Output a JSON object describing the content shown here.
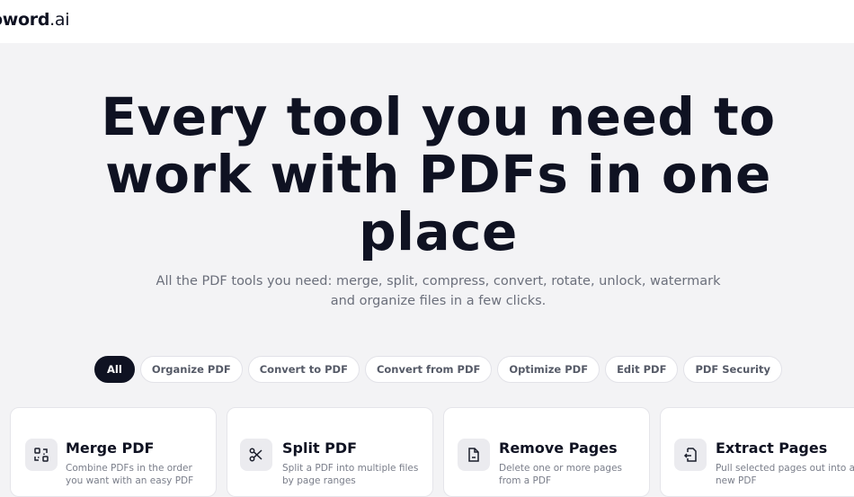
{
  "header": {
    "logo_main": "oword",
    "logo_tld": ".ai"
  },
  "hero": {
    "title_line1": "Every tool you need to",
    "title_line2": "work with PDFs in one",
    "title_line3": "place",
    "subtitle_line1": "All the PDF tools you need: merge, split, compress, convert, rotate, unlock, watermark",
    "subtitle_line2": "and organize files in a few clicks."
  },
  "tabs": [
    {
      "label": "All",
      "active": true
    },
    {
      "label": "Organize PDF"
    },
    {
      "label": "Convert to PDF"
    },
    {
      "label": "Convert from PDF"
    },
    {
      "label": "Optimize PDF"
    },
    {
      "label": "Edit PDF"
    },
    {
      "label": "PDF Security"
    }
  ],
  "tools": [
    {
      "title": "Merge PDF",
      "icon": "merge-icon",
      "desc": "Combine PDFs in the order you want with an easy PDF"
    },
    {
      "title": "Split PDF",
      "icon": "scissors-icon",
      "desc": "Split a PDF into multiple files by page ranges"
    },
    {
      "title": "Remove Pages",
      "icon": "remove-page-icon",
      "desc": "Delete one or more pages from a PDF"
    },
    {
      "title": "Extract Pages",
      "icon": "extract-page-icon",
      "desc": "Pull selected pages out into a new PDF"
    }
  ],
  "colors": {
    "background": "#f3f3f5",
    "text_dark": "#0f1222",
    "text_muted": "#6b6f7b",
    "active_tab": "#0f1222"
  }
}
